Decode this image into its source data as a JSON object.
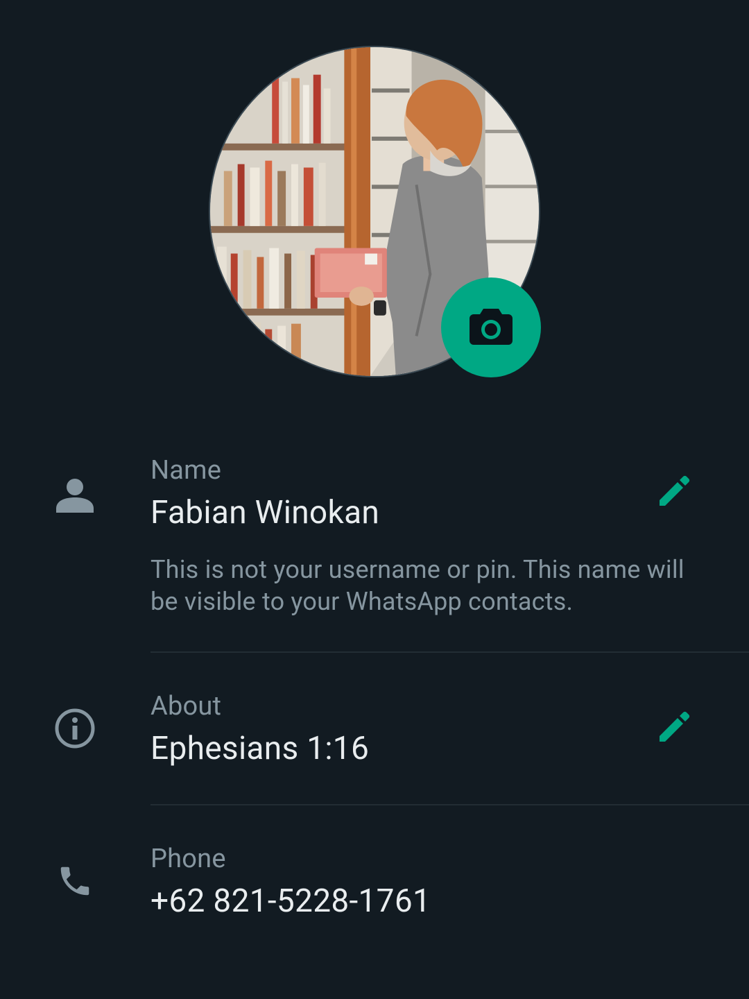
{
  "profile": {
    "photo_alt": "Profile photo",
    "camera_icon": "camera-icon"
  },
  "name_row": {
    "icon": "person-icon",
    "label": "Name",
    "value": "Fabian Winokan",
    "hint": "This is not your username or pin. This name will be visible to your WhatsApp contacts.",
    "edit_icon": "pencil-icon"
  },
  "about_row": {
    "icon": "info-icon",
    "label": "About",
    "value": "Ephesians 1:16",
    "edit_icon": "pencil-icon"
  },
  "phone_row": {
    "icon": "phone-icon",
    "label": "Phone",
    "value": "+62 821-5228-1761"
  },
  "colors": {
    "background": "#121b22",
    "accent": "#00a884",
    "primary_text": "#e9edef",
    "secondary_text": "#8696a0",
    "divider": "#222d34"
  }
}
